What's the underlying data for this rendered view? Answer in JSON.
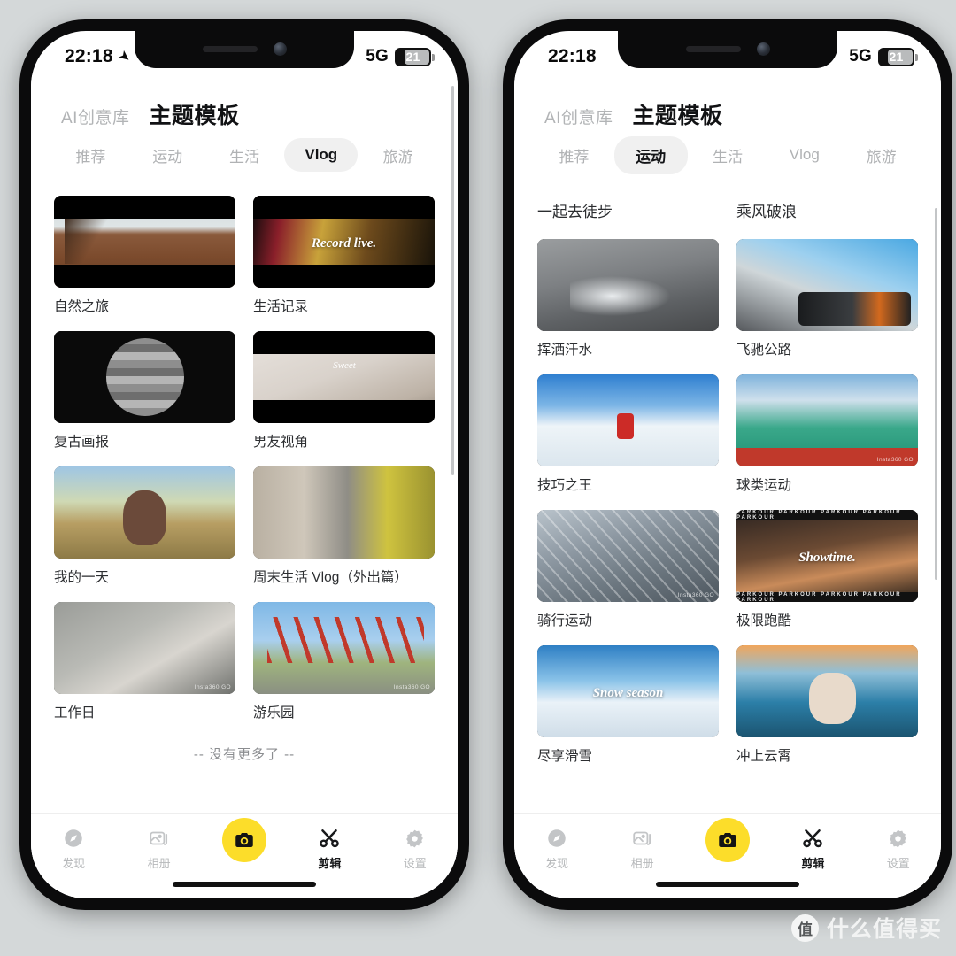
{
  "background_color": "#d4d8d9",
  "accent_color": "#fcdd2a",
  "status_bar": {
    "time": "22:18",
    "location_icon": "location-arrow-icon",
    "network": "5G",
    "battery_percent": "21"
  },
  "header": {
    "brand": "AI创意库",
    "title": "主题模板"
  },
  "tabs": [
    "推荐",
    "运动",
    "生活",
    "Vlog",
    "旅游"
  ],
  "left_phone": {
    "active_tab": "Vlog",
    "cards": [
      {
        "label": "自然之旅",
        "art": "art-forest",
        "letterbox": true
      },
      {
        "label": "生活记录",
        "art": "art-record",
        "letterbox": true,
        "overlay_text": "Record live."
      },
      {
        "label": "复古画报",
        "art": "art-retro",
        "letterbox": false
      },
      {
        "label": "男友视角",
        "art": "art-sweet",
        "letterbox": true
      },
      {
        "label": "我的一天",
        "art": "art-girl",
        "letterbox": false
      },
      {
        "label": "周末生活 Vlog（外出篇）",
        "art": "art-metro",
        "letterbox": false
      },
      {
        "label": "工作日",
        "art": "art-work",
        "letterbox": false,
        "watermark": "Insta360 GO"
      },
      {
        "label": "游乐园",
        "art": "art-park",
        "letterbox": false,
        "watermark": "Insta360 GO"
      }
    ],
    "end_text": "-- 没有更多了 --"
  },
  "right_phone": {
    "active_tab": "运动",
    "section_headers": [
      "一起去徒步",
      "乘风破浪"
    ],
    "cards": [
      {
        "label": "挥洒汗水",
        "art": "art-sweat"
      },
      {
        "label": "飞驰公路",
        "art": "art-road"
      },
      {
        "label": "技巧之王",
        "art": "art-ski"
      },
      {
        "label": "球类运动",
        "art": "art-ball",
        "watermark": "Insta360 GO"
      },
      {
        "label": "骑行运动",
        "art": "art-bike",
        "watermark": "Insta360 GO"
      },
      {
        "label": "极限跑酷",
        "art": "art-parkour",
        "overlay_text": "Showtime.",
        "strip_text": "PARKOUR"
      },
      {
        "label": "尽享滑雪",
        "art": "art-snow",
        "overlay_text": "Snow season"
      },
      {
        "label": "冲上云霄",
        "art": "art-fly"
      }
    ]
  },
  "bottom_nav": {
    "items": [
      {
        "label": "发现",
        "icon": "compass-icon",
        "active": false
      },
      {
        "label": "相册",
        "icon": "photo-album-icon",
        "active": false
      },
      {
        "label": "",
        "icon": "camera-shutter-icon",
        "active": false
      },
      {
        "label": "剪辑",
        "icon": "scissors-icon",
        "active": true
      },
      {
        "label": "设置",
        "icon": "gear-icon",
        "active": false
      }
    ]
  },
  "watermark": {
    "logo_char": "值",
    "text": "什么值得买"
  }
}
